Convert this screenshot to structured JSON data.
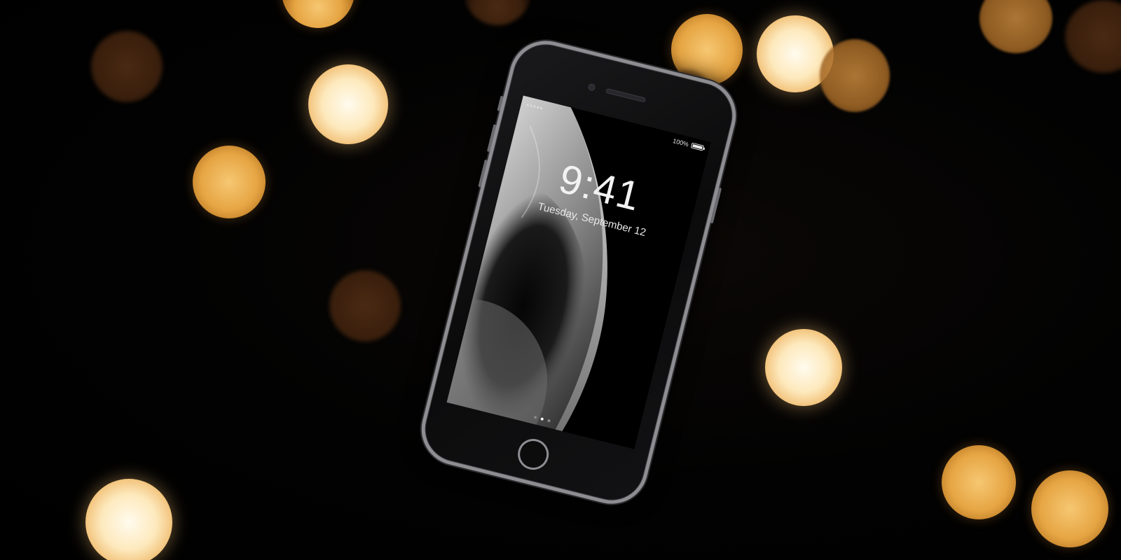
{
  "scene": {
    "background_color": "#000000",
    "bokeh_color": "#e6a543",
    "bokeh_highlight_color": "#fff6dc"
  },
  "phone": {
    "frame_color": "#8e8e92",
    "status_bar": {
      "battery_percent": "100%",
      "battery_level": 1.0
    },
    "lock_screen": {
      "time": "9:41",
      "date": "Tuesday, September 12"
    },
    "page_indicator": {
      "count": 3,
      "active_index": 1
    }
  }
}
